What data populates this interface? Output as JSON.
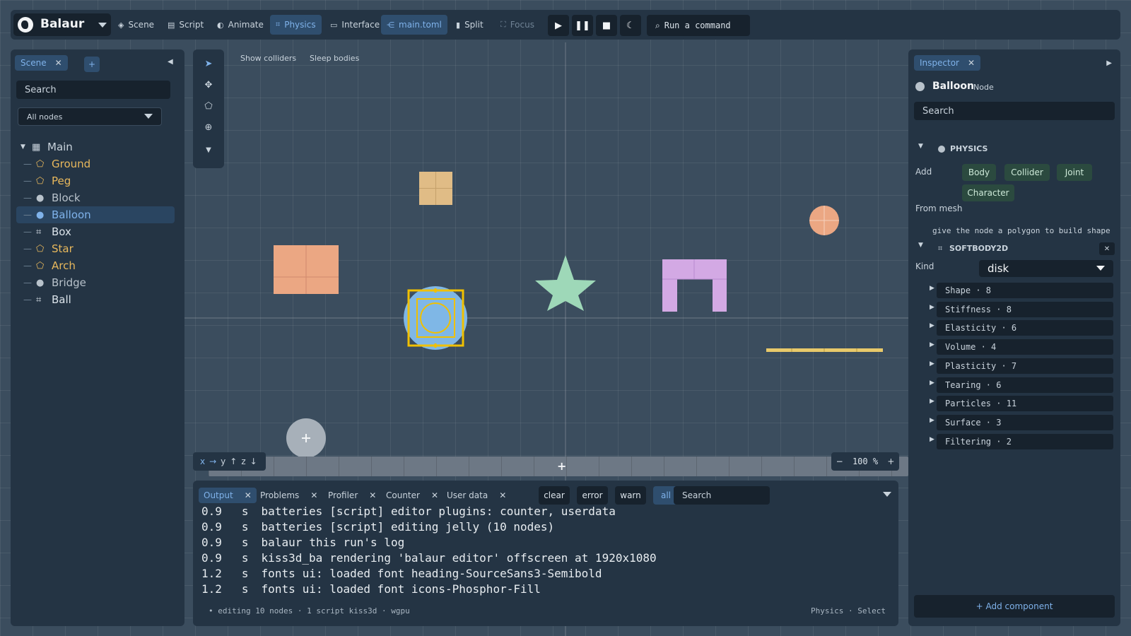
{
  "app": {
    "name": "Balaur"
  },
  "toolbar": {
    "tabs": [
      {
        "label": "Scene",
        "icon": "cube-icon"
      },
      {
        "label": "Script",
        "icon": "script-icon"
      },
      {
        "label": "Animate",
        "icon": "animate-icon"
      },
      {
        "label": "Physics",
        "icon": "physics-icon"
      },
      {
        "label": "Interface",
        "icon": "interface-icon"
      },
      {
        "label": "main.toml",
        "icon": "graph-icon"
      },
      {
        "label": "Split",
        "icon": "split-icon"
      },
      {
        "label": "Focus",
        "icon": "focus-icon"
      }
    ],
    "run_command": "Run a command"
  },
  "scene_panel": {
    "tab": "Scene",
    "search_placeholder": "Search",
    "filter": "All nodes",
    "root": "Main",
    "nodes": [
      {
        "label": "Ground",
        "icon": "polygon-icon",
        "color": "#e8b85c"
      },
      {
        "label": "Peg",
        "icon": "polygon-icon",
        "color": "#e8b85c"
      },
      {
        "label": "Block",
        "icon": "circle-icon",
        "color": "#b8c2cb"
      },
      {
        "label": "Balloon",
        "icon": "circle-icon",
        "color": "#7fb2ea"
      },
      {
        "label": "Box",
        "icon": "softbody-icon",
        "color": "#dbe3ea"
      },
      {
        "label": "Star",
        "icon": "polygon-icon",
        "color": "#e8b85c"
      },
      {
        "label": "Arch",
        "icon": "polygon-icon",
        "color": "#e8b85c"
      },
      {
        "label": "Bridge",
        "icon": "circle-icon",
        "color": "#b8c2cb"
      },
      {
        "label": "Ball",
        "icon": "softbody-icon",
        "color": "#dbe3ea"
      }
    ]
  },
  "viewport": {
    "toggles": [
      "Show colliders",
      "Sleep bodies"
    ],
    "axes": {
      "x": "x",
      "y": "y",
      "z": "z"
    },
    "zoom": "100 %"
  },
  "console": {
    "tabs": [
      "Output",
      "Problems",
      "Profiler",
      "Counter",
      "User data"
    ],
    "filters": [
      "clear",
      "error",
      "warn",
      "all"
    ],
    "search_placeholder": "Search",
    "log": [
      {
        "time": "0.9",
        "unit": "s",
        "source": "batteries",
        "msg": "[script] editor plugins: counter, userdata"
      },
      {
        "time": "0.9",
        "unit": "s",
        "source": "batteries",
        "msg": "[script] editing jelly (10 nodes)"
      },
      {
        "time": "0.9",
        "unit": "s",
        "source": "balaur",
        "msg": "this run's log"
      },
      {
        "time": "0.9",
        "unit": "s",
        "source": "kiss3d_ba",
        "msg": "rendering 'balaur editor' offscreen at 1920x1080"
      },
      {
        "time": "1.2",
        "unit": "s",
        "source": "fonts",
        "msg": "ui: loaded font heading-SourceSans3-Semibold"
      },
      {
        "time": "1.2",
        "unit": "s",
        "source": "fonts",
        "msg": "ui: loaded font icons-Phosphor-Fill"
      }
    ],
    "status_left": "• editing 10 nodes · 1 script kiss3d · wgpu",
    "status_right": "Physics · Select"
  },
  "inspector": {
    "tab": "Inspector",
    "node_name": "Balloon",
    "node_type": "Node",
    "search_placeholder": "Search",
    "physics_header": "PHYSICS",
    "add_label": "Add",
    "add_buttons": [
      "Body",
      "Collider",
      "Joint",
      "Character"
    ],
    "from_mesh": "From mesh",
    "mesh_hint": "give the node a polygon to build shape",
    "softbody_header": "SOFTBODY2D",
    "kind_label": "Kind",
    "kind_value": "disk",
    "properties": [
      "Shape · 8",
      "Stiffness · 8",
      "Elasticity · 6",
      "Volume · 4",
      "Plasticity · 7",
      "Tearing · 6",
      "Particles · 11",
      "Surface · 3",
      "Filtering · 2"
    ],
    "add_component": "+ Add component"
  },
  "colors": {
    "accent": "#7fb2ea",
    "selection": "#f0c000",
    "salmon": "#eba783",
    "tan": "#e0bc86",
    "mint": "#9ed8b8",
    "lilac": "#d3a9e4",
    "balloon": "#7fb7e6"
  }
}
